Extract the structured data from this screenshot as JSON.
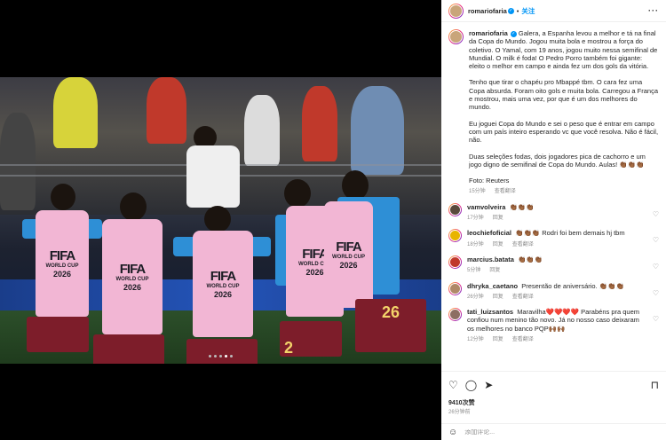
{
  "post": {
    "username": "romariofaria",
    "follow_label": "关注",
    "more_label": "···"
  },
  "media": {
    "fifa_text": "FIFA",
    "world_cup_text": "WORLD CUP",
    "year_text": "2026",
    "jersey_numbers": [
      "26",
      "2"
    ],
    "carousel_dots": 5,
    "carousel_active_index": 3
  },
  "caption": {
    "username": "romariofaria",
    "paragraphs": [
      "Galera, a Espanha levou a melhor e tá na final da Copa do Mundo. Jogou muita bola e mostrou a força do coletivo. O Yamal, com 19 anos, jogou muito nessa semifinal de Mundial. O milk é foda! O Pedro Porro também foi gigante: eleito o melhor em campo e ainda fez um dos gols da vitória.",
      "Tenho que tirar o chapéu pro Mbappé tbm. O cara fez uma Copa absurda. Foram oito gols e muita bola. Carregou a França e mostrou, mais uma vez, por que é um dos melhores do mundo.",
      "Eu joguei Copa do Mundo e sei o peso que é entrar em campo com um país inteiro esperando vc que você resolva. Não é fácil, não.",
      "Duas seleções fodas, dois jogadores pica de cachorro e um jogo digno de semifinal de Copa do Mundo. Aulas! 👏🏾👏🏾👏🏾",
      "Foto: Reuters"
    ],
    "time": "15分钟",
    "translate": "查看翻译"
  },
  "comments": [
    {
      "username": "vamvolveira",
      "text": "👏🏾👏🏾👏🏾",
      "time": "17分钟",
      "reply": "回复",
      "translate": "",
      "avatar_color": "#5a4a3c"
    },
    {
      "username": "leochiefoficial",
      "text": "👏🏾👏🏾👏🏾 Rodri foi bem demais hj tbm",
      "time": "18分钟",
      "reply": "回复",
      "translate": "查看翻译",
      "avatar_color": "#e8b400"
    },
    {
      "username": "marcius.batata",
      "text": "👏🏾👏🏾👏🏾",
      "time": "5分钟",
      "reply": "回复",
      "translate": "",
      "avatar_color": "#c0392b"
    },
    {
      "username": "dhryka_caetano",
      "text": "Presentão de aniversário. 👏🏾👏🏾👏🏾",
      "time": "26分钟",
      "reply": "回复",
      "translate": "查看翻译",
      "avatar_color": "#b08968"
    },
    {
      "username": "tati_luizsantos",
      "text": "Maravilha❤️❤️❤️❤️ Parabéns pra quem confiou num menino tão novo. Já no nosso caso deixaram os melhores no banco PQP🙌🏾🙌🏾",
      "time": "12分钟",
      "reply": "回复",
      "translate": "查看翻译",
      "avatar_color": "#8d6e63"
    }
  ],
  "actions": {
    "like_icon": "heart-icon",
    "comment_icon": "comment-icon",
    "share_icon": "share-icon",
    "save_icon": "bookmark-icon",
    "likes": "9410次赞",
    "posted": "26分钟前"
  },
  "add_comment": {
    "placeholder": "添加评论...",
    "emoji_icon": "smiley-icon"
  },
  "colors": {
    "link_blue": "#0095f6",
    "muted": "#8e8e8e",
    "bib_pink": "#f2b6d4",
    "shorts_maroon": "#7d1d2a"
  }
}
